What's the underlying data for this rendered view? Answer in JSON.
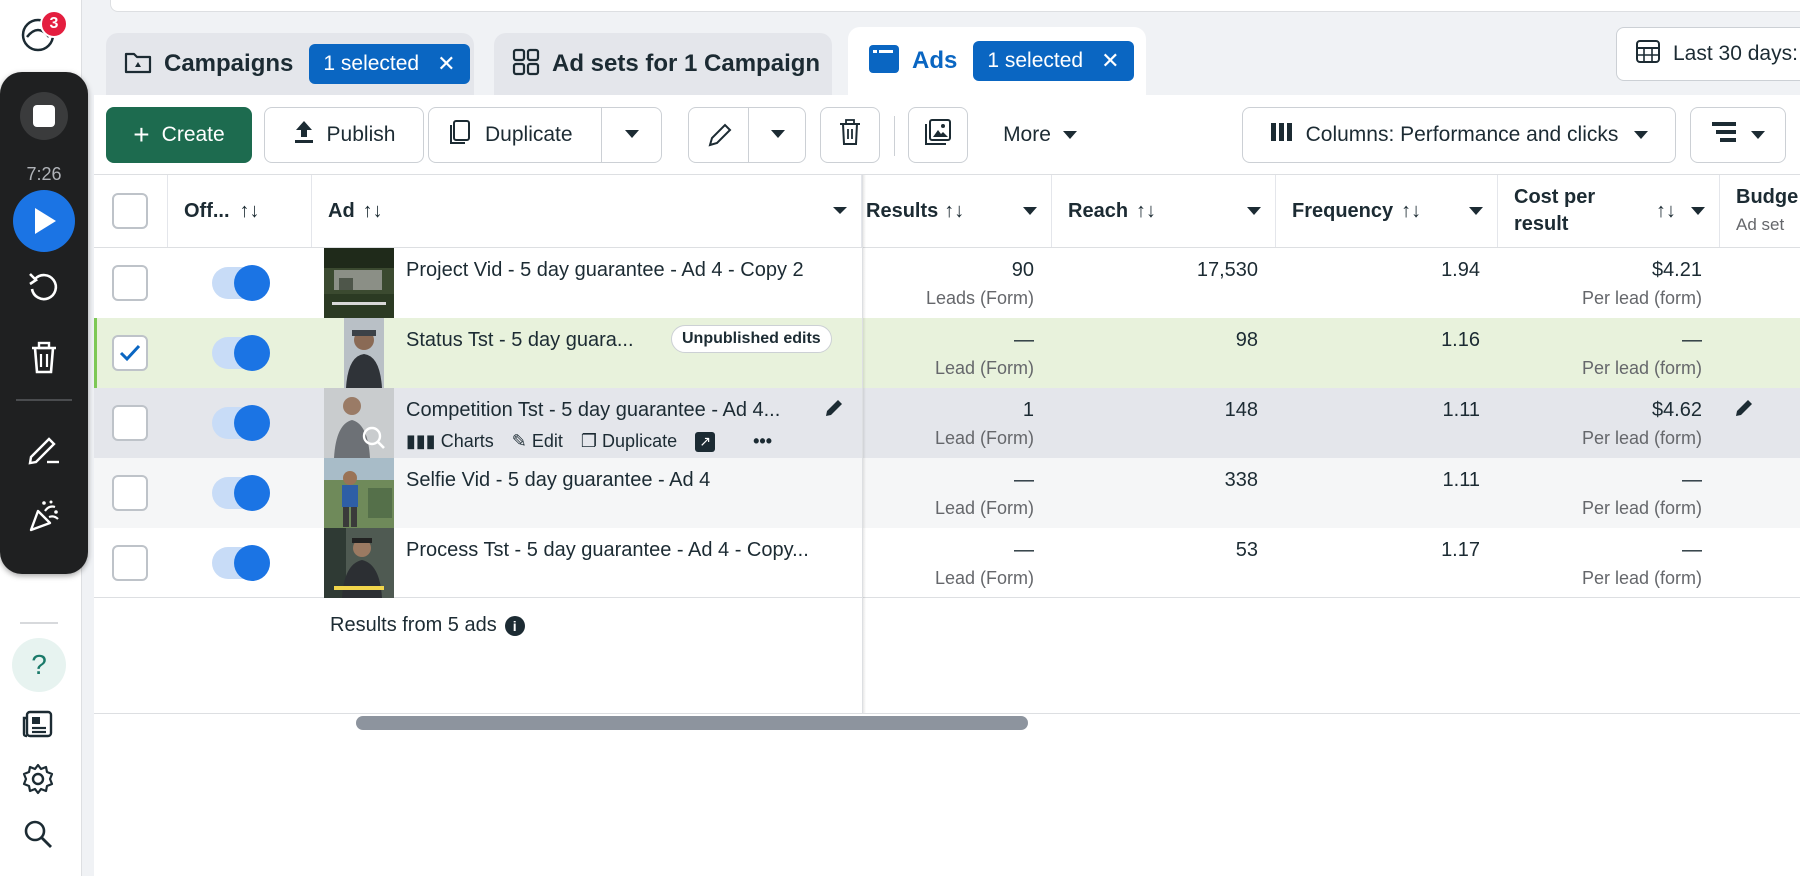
{
  "nav": {
    "badge_count": "3",
    "help_label": "?"
  },
  "recorder": {
    "time": "7:26"
  },
  "tabs": {
    "campaigns": {
      "label": "Campaigns",
      "selected": "1 selected"
    },
    "adsets": {
      "label": "Ad sets for 1 Campaign"
    },
    "ads": {
      "label": "Ads",
      "selected": "1 selected"
    }
  },
  "date_range": "Last 30 days:",
  "toolbar": {
    "create": "Create",
    "publish": "Publish",
    "duplicate": "Duplicate",
    "more": "More",
    "columns": "Columns: Performance and clicks"
  },
  "table": {
    "headers": {
      "off": "Off...",
      "ad": "Ad",
      "results": "Results",
      "reach": "Reach",
      "frequency": "Frequency",
      "cost_per_result_1": "Cost per",
      "cost_per_result_2": "result",
      "budget": "Budge",
      "budget_sub": "Ad set"
    },
    "rows": [
      {
        "name": "Project Vid - 5 day guarantee - Ad 4 - Copy 2",
        "results": "90",
        "results_sub": "Leads (Form)",
        "reach": "17,530",
        "frequency": "1.94",
        "cost": "$4.21",
        "cost_sub": "Per lead (form)"
      },
      {
        "name": "Status Tst - 5 day guara...",
        "badge": "Unpublished edits",
        "results": "—",
        "results_sub": "Lead (Form)",
        "reach": "98",
        "frequency": "1.16",
        "cost": "—",
        "cost_sub": "Per lead (form)"
      },
      {
        "name": "Competition Tst - 5 day guarantee - Ad 4...",
        "results": "1",
        "results_sub": "Lead (Form)",
        "reach": "148",
        "frequency": "1.11",
        "cost": "$4.62",
        "cost_sub": "Per lead (form)"
      },
      {
        "name": "Selfie Vid - 5 day guarantee - Ad 4",
        "results": "—",
        "results_sub": "Lead (Form)",
        "reach": "338",
        "frequency": "1.11",
        "cost": "—",
        "cost_sub": "Per lead (form)"
      },
      {
        "name": "Process Tst - 5 day guarantee - Ad 4 - Copy...",
        "results": "—",
        "results_sub": "Lead (Form)",
        "reach": "53",
        "frequency": "1.17",
        "cost": "—",
        "cost_sub": "Per lead (form)"
      }
    ],
    "row_actions": {
      "charts": "Charts",
      "edit": "Edit",
      "duplicate": "Duplicate",
      "more": "•••"
    },
    "footer": "Results from 5 ads"
  },
  "colors": {
    "accent": "#0a66c2",
    "create_green": "#1d6b4f",
    "selected_row": "#e8f2dc",
    "hover_row": "#e4e6eb"
  }
}
